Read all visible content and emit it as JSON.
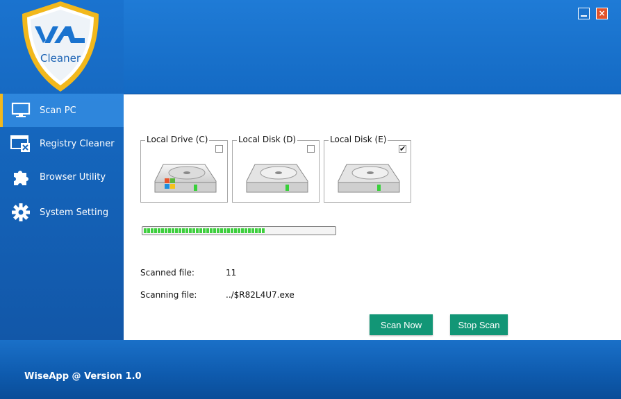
{
  "app": {
    "logo_text": "Cleaner",
    "logo_mark": "WA"
  },
  "sidebar": {
    "items": [
      {
        "label": "Scan PC",
        "icon": "monitor-icon",
        "active": true
      },
      {
        "label": "Registry Cleaner",
        "icon": "registry-window-icon",
        "active": false
      },
      {
        "label": "Browser Utility",
        "icon": "puzzle-icon",
        "active": false
      },
      {
        "label": "System Setting",
        "icon": "gear-icon",
        "active": false
      }
    ]
  },
  "window_controls": {
    "minimize": "minimize-icon",
    "close": "×"
  },
  "drives": [
    {
      "label": "Local Drive (C)",
      "checked": false,
      "system": true
    },
    {
      "label": "Local Disk (D)",
      "checked": false,
      "system": false
    },
    {
      "label": "Local Disk (E)",
      "checked": true,
      "system": false
    }
  ],
  "progress": {
    "value": 0.64
  },
  "scan_info": {
    "scanned_label": "Scanned file:",
    "scanned_value": "11",
    "scanning_label": "Scanning file:",
    "scanning_value": "../$R82L4U7.exe"
  },
  "actions": {
    "scan_now": "Scan Now",
    "stop_scan": "Stop Scan"
  },
  "footer": {
    "version_text": "WiseApp @ Version 1.0"
  },
  "colors": {
    "accent": "#f2b81c",
    "button": "#129676",
    "progress": "#3ecf3e",
    "close": "#e0542c"
  }
}
